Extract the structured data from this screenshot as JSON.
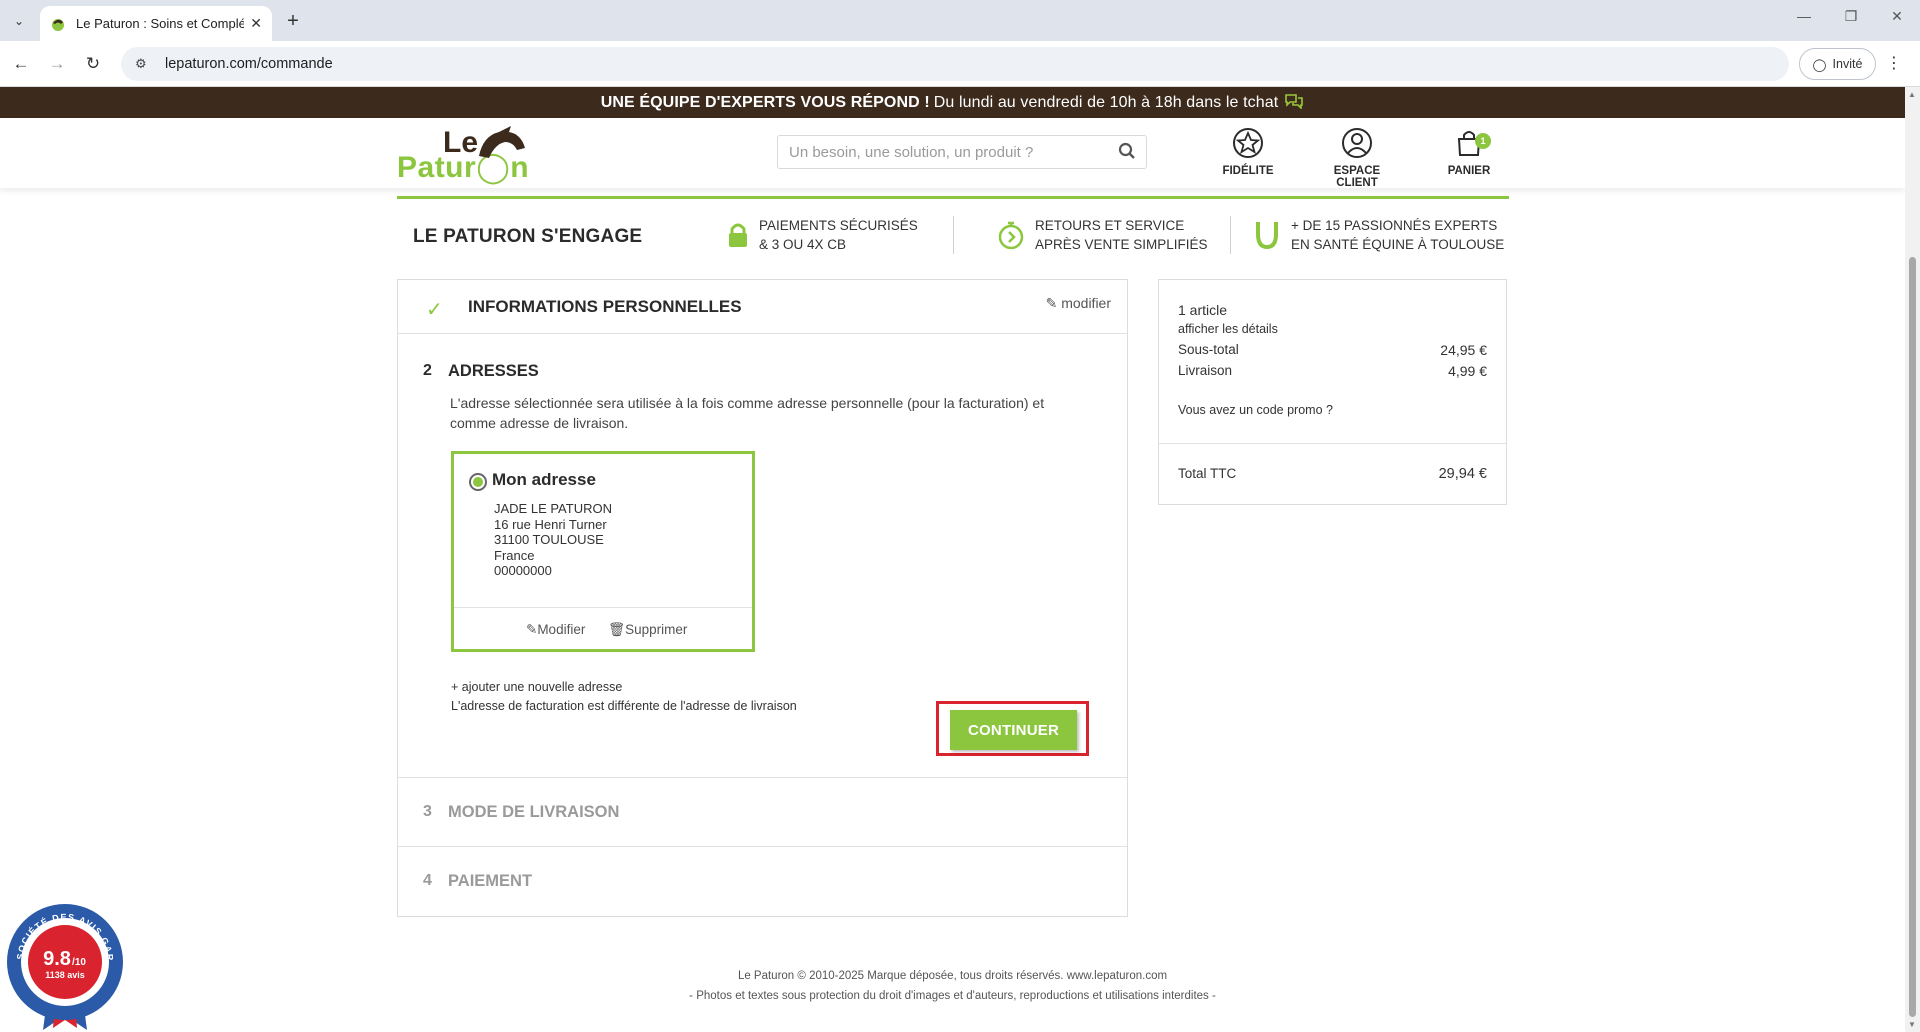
{
  "browser": {
    "tab_title": "Le Paturon : Soins et Complém",
    "url": "lepaturon.com/commande",
    "profile_label": "Invité"
  },
  "site": {
    "promo_bold": "UNE ÉQUIPE D'EXPERTS VOUS RÉPOND !",
    "promo_normal": "Du lundi au vendredi de 10h à 18h dans le tchat",
    "logo_le": "Le",
    "logo_paturon": "Patur  n",
    "search_placeholder": "Un besoin, une solution, un produit ?",
    "nav": {
      "fidelite": "FIDÉLITE",
      "espace_client": "ESPACE CLIENT",
      "panier": "PANIER",
      "panier_count": "1"
    }
  },
  "engage": {
    "title": "LE PATURON S'ENGAGE",
    "item1_l1": "PAIEMENTS SÉCURISÉS",
    "item1_l2": "& 3 OU 4X CB",
    "item2_l1": "RETOURS ET SERVICE",
    "item2_l2": "APRÈS VENTE SIMPLIFIÉS",
    "item3_l1": "+ DE 15 PASSIONNÉS EXPERTS",
    "item3_l2": "EN SANTÉ ÉQUINE À TOULOUSE"
  },
  "checkout": {
    "step1_title": "INFORMATIONS PERSONNELLES",
    "step1_modify": "modifier",
    "step2_num": "2",
    "step2_title": "ADRESSES",
    "step2_desc": "L'adresse sélectionnée sera utilisée à la fois comme adresse personnelle (pour la facturation) et comme adresse de livraison.",
    "address": {
      "title": "Mon adresse",
      "name": "JADE LE PATURON",
      "street": "16 rue Henri Turner",
      "city": "31100 TOULOUSE",
      "country": "France",
      "phone": "00000000",
      "edit": "Modifier",
      "delete": "Supprimer"
    },
    "add_address": "ajouter une nouvelle adresse",
    "different_billing": "L'adresse de facturation est différente de l'adresse de livraison",
    "continue": "CONTINUER",
    "step3_num": "3",
    "step3_title": "MODE DE LIVRAISON",
    "step4_num": "4",
    "step4_title": "PAIEMENT"
  },
  "summary": {
    "articles": "1 article",
    "details": "afficher les détails",
    "subtotal_label": "Sous-total",
    "subtotal_value": "24,95 €",
    "shipping_label": "Livraison",
    "shipping_value": "4,99 €",
    "promo_code": "Vous avez un code promo ?",
    "total_label": "Total TTC",
    "total_value": "29,94 €"
  },
  "footer": {
    "line1": "Le Paturon © 2010-2025 Marque déposée, tous droits réservés. www.lepaturon.com",
    "line2": "- Photos et textes sous protection du droit d'images et d'auteurs, reproductions et utilisations interdites -"
  },
  "seal": {
    "score": "9.8",
    "scale": "/10",
    "reviews": "1138 avis",
    "ring_text": "SOCIÉTÉ DES AVIS GARANTIS"
  },
  "colors": {
    "brand_green": "#8cc63f",
    "brand_brown": "#3c2a1c",
    "highlight_red": "#d9232e"
  }
}
